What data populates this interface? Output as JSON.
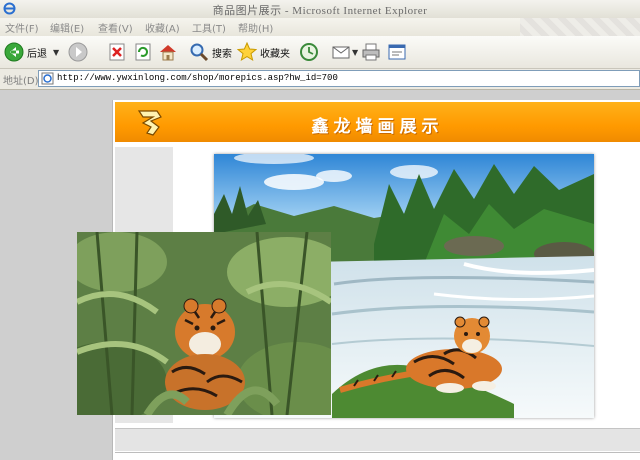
{
  "window": {
    "title": "商品图片展示 - Microsoft Internet Explorer"
  },
  "menu": [
    "文件(F)",
    "编辑(E)",
    "查看(V)",
    "收藏(A)",
    "工具(T)",
    "帮助(H)"
  ],
  "toolbar": {
    "back": "后退",
    "search": "搜索",
    "favorites": "收藏夹"
  },
  "address": {
    "label": "地址(D)",
    "url": "http://www.ywxinlong.com/shop/morepics.asp?hw_id=700"
  },
  "page": {
    "banner_title": "鑫龙墙画展示"
  },
  "colors": {
    "banner": "#ff9a00",
    "sky": "#3a8fd8",
    "foliage": "#2f6b2a",
    "water": "#e8f0f4",
    "tiger": "#d9782a"
  }
}
